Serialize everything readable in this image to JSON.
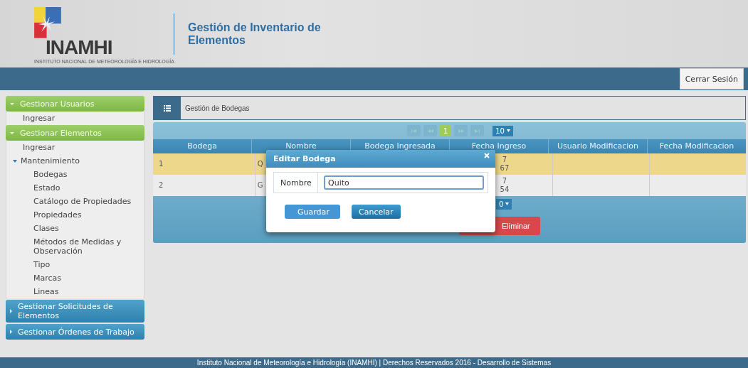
{
  "header": {
    "logo_text": "INAMHI",
    "logo_subtitle": "INSTITUTO NACIONAL DE METEOROLOGÍA E HIDROLOGÍA",
    "title": "Gestión de Inventario de Elementos"
  },
  "top_bar": {
    "logout_button": "Cerrar Sesión"
  },
  "sidebar": {
    "sections": [
      {
        "label": "Gestionar Usuarios",
        "expanded": true,
        "items": [
          {
            "label": "Ingresar"
          }
        ]
      },
      {
        "label": "Gestionar Elementos",
        "expanded": true,
        "items": [
          {
            "label": "Ingresar"
          },
          {
            "label": "Mantenimiento",
            "expanded": true,
            "children": [
              {
                "label": "Bodegas"
              },
              {
                "label": "Estado"
              },
              {
                "label": "Catálogo de Propiedades"
              },
              {
                "label": "Propiedades"
              },
              {
                "label": "Clases"
              },
              {
                "label": "Métodos de Medidas y Observación"
              },
              {
                "label": "Tipo"
              },
              {
                "label": "Marcas"
              },
              {
                "label": "Lineas"
              }
            ]
          }
        ]
      },
      {
        "label": "Gestionar Solicitudes de Elementos",
        "expanded": false
      },
      {
        "label": "Gestionar Órdenes de Trabajo",
        "expanded": false
      }
    ]
  },
  "panel": {
    "title": "Gestión de Bodegas",
    "paginator": {
      "pages": [
        {
          "label": "1",
          "selected": true
        }
      ],
      "page_size": "10"
    },
    "table": {
      "columns": [
        "Bodega",
        "Nombre",
        "Bodega Ingresada",
        "Fecha Ingreso",
        "Usuario Modificacion",
        "Fecha Modificacion"
      ],
      "rows": [
        {
          "selected": true,
          "cells": [
            "1",
            "Q",
            "",
            "7\n67",
            "",
            ""
          ]
        },
        {
          "selected": false,
          "cells": [
            "2",
            "G",
            "",
            "7\n54",
            "",
            ""
          ]
        }
      ]
    },
    "bottom_page_size": "0",
    "delete_button": "Eliminar"
  },
  "dialog": {
    "title": "Editar Bodega",
    "field_label": "Nombre",
    "field_value": "Quito",
    "buttons": [
      {
        "label": "Guardar",
        "kind": "primary"
      },
      {
        "label": "Cancelar",
        "kind": "secondary"
      }
    ]
  },
  "footer": "Instituto Nacional de Meteorología e Hidrología (INAMHI) | Derechos Reservados 2016 - Desarrollo de Sistemas"
}
